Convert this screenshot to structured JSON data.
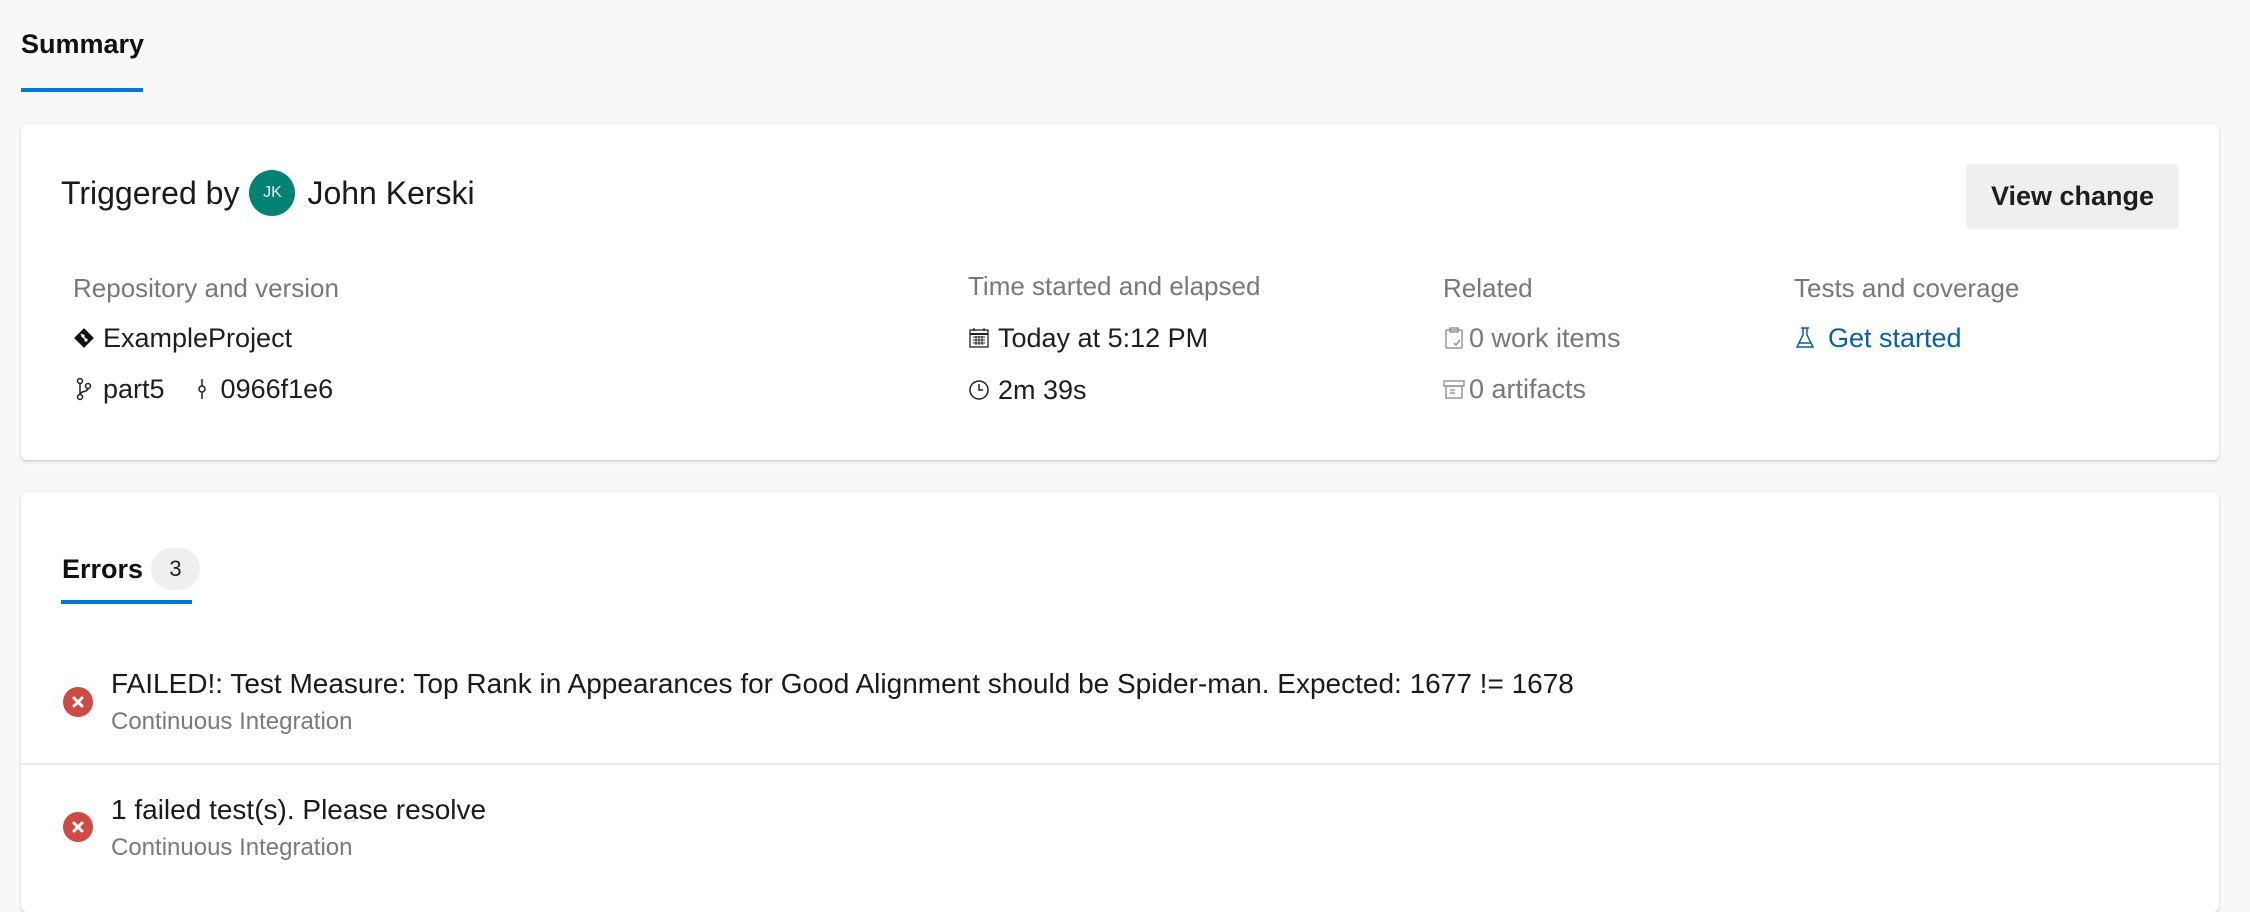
{
  "tabs": {
    "summary_label": "Summary"
  },
  "trigger": {
    "prefix": "Triggered by",
    "user_initials": "JK",
    "user_name": "John Kerski",
    "avatar_color": "#038273",
    "view_change_label": "View change"
  },
  "repository": {
    "label": "Repository and version",
    "repo_name": "ExampleProject",
    "branch": "part5",
    "commit": "0966f1e6",
    "repo_icon": "git-repo-icon",
    "branch_icon": "branch-icon",
    "commit_icon": "commit-icon"
  },
  "time": {
    "label": "Time started and elapsed",
    "started": "Today at 5:12 PM",
    "elapsed": "2m 39s",
    "started_icon": "calendar-icon",
    "elapsed_icon": "clock-icon"
  },
  "related": {
    "label": "Related",
    "work_items": "0 work items",
    "artifacts": "0 artifacts",
    "work_items_icon": "clipboard-icon",
    "artifacts_icon": "archive-icon"
  },
  "tests": {
    "label": "Tests and coverage",
    "link_label": "Get started",
    "link_icon": "flask-icon",
    "link_color": "#0b5ea8"
  },
  "errors": {
    "tab_label": "Errors",
    "count": "3",
    "accent_color": "#0078d4",
    "error_color": "#cd4a45",
    "items": [
      {
        "title": "FAILED!: Test Measure: Top Rank in Appearances for Good Alignment should be Spider-man. Expected: 1677 != 1678",
        "source": "Continuous Integration"
      },
      {
        "title": "1 failed test(s). Please resolve",
        "source": "Continuous Integration"
      }
    ]
  }
}
